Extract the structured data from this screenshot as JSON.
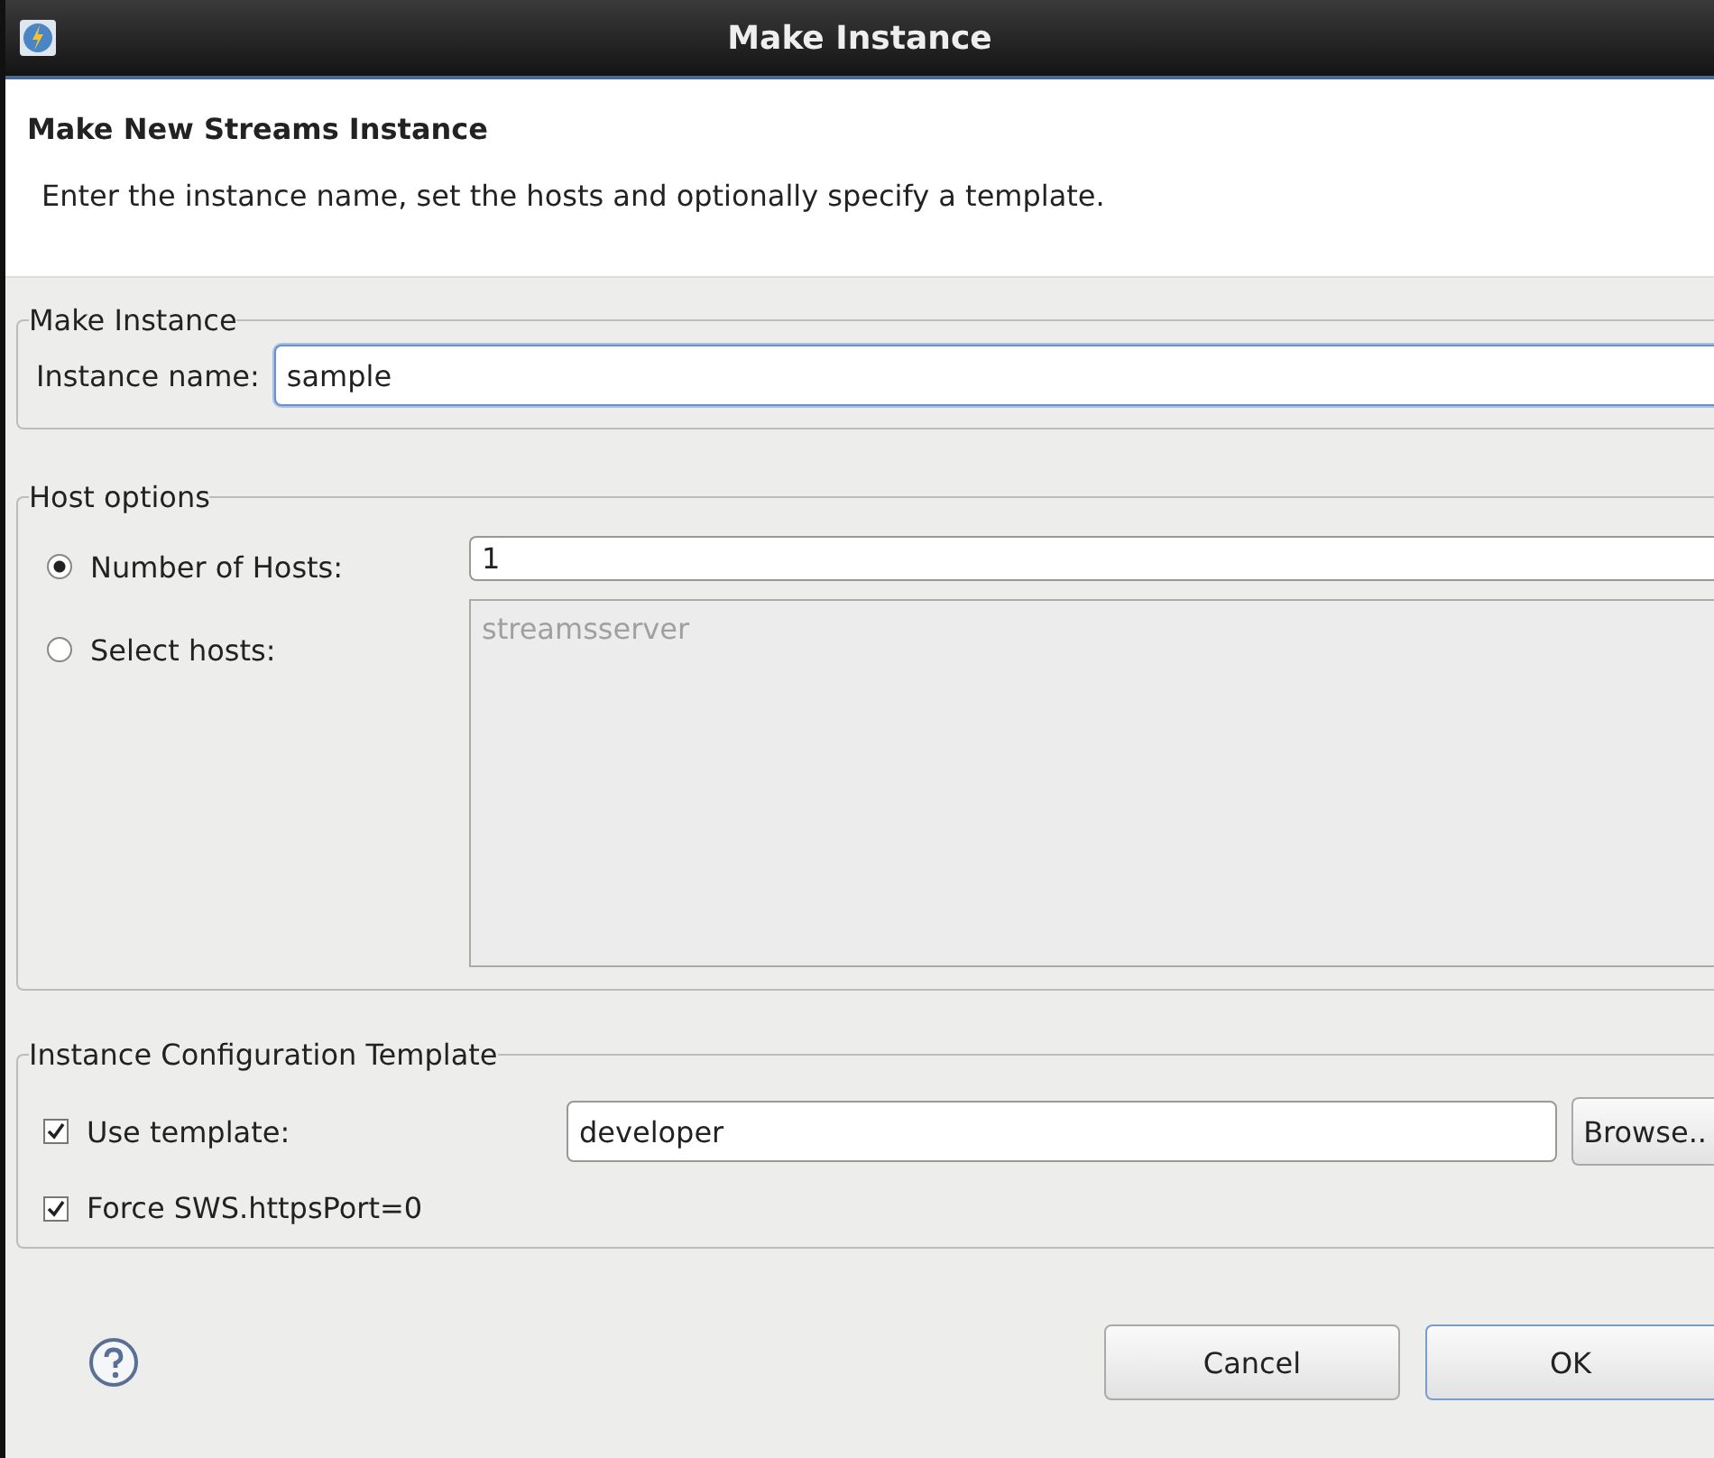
{
  "window": {
    "title": "Make Instance"
  },
  "header": {
    "title": "Make New Streams Instance",
    "description": "Enter the instance name, set the hosts and optionally specify a template."
  },
  "make_instance": {
    "legend": "Make Instance",
    "label": "Instance name:",
    "value": "sample"
  },
  "host_options": {
    "legend": "Host options",
    "options": [
      {
        "label": "Number of Hosts:",
        "selected": true
      },
      {
        "label": "Select hosts:",
        "selected": false
      }
    ],
    "hosts_value": "1",
    "hosts_list": {
      "disabled": true,
      "items": [
        "streamsserver"
      ]
    }
  },
  "template": {
    "legend": "Instance Configuration Template",
    "use_template": {
      "label": "Use template:",
      "checked": true,
      "value": "developer",
      "button": "Browse.."
    },
    "force": {
      "label": "Force SWS.httpsPort=0",
      "checked": true
    }
  },
  "buttons": [
    {
      "label": "Cancel",
      "default": false
    },
    {
      "label": "OK",
      "default": true
    }
  ]
}
